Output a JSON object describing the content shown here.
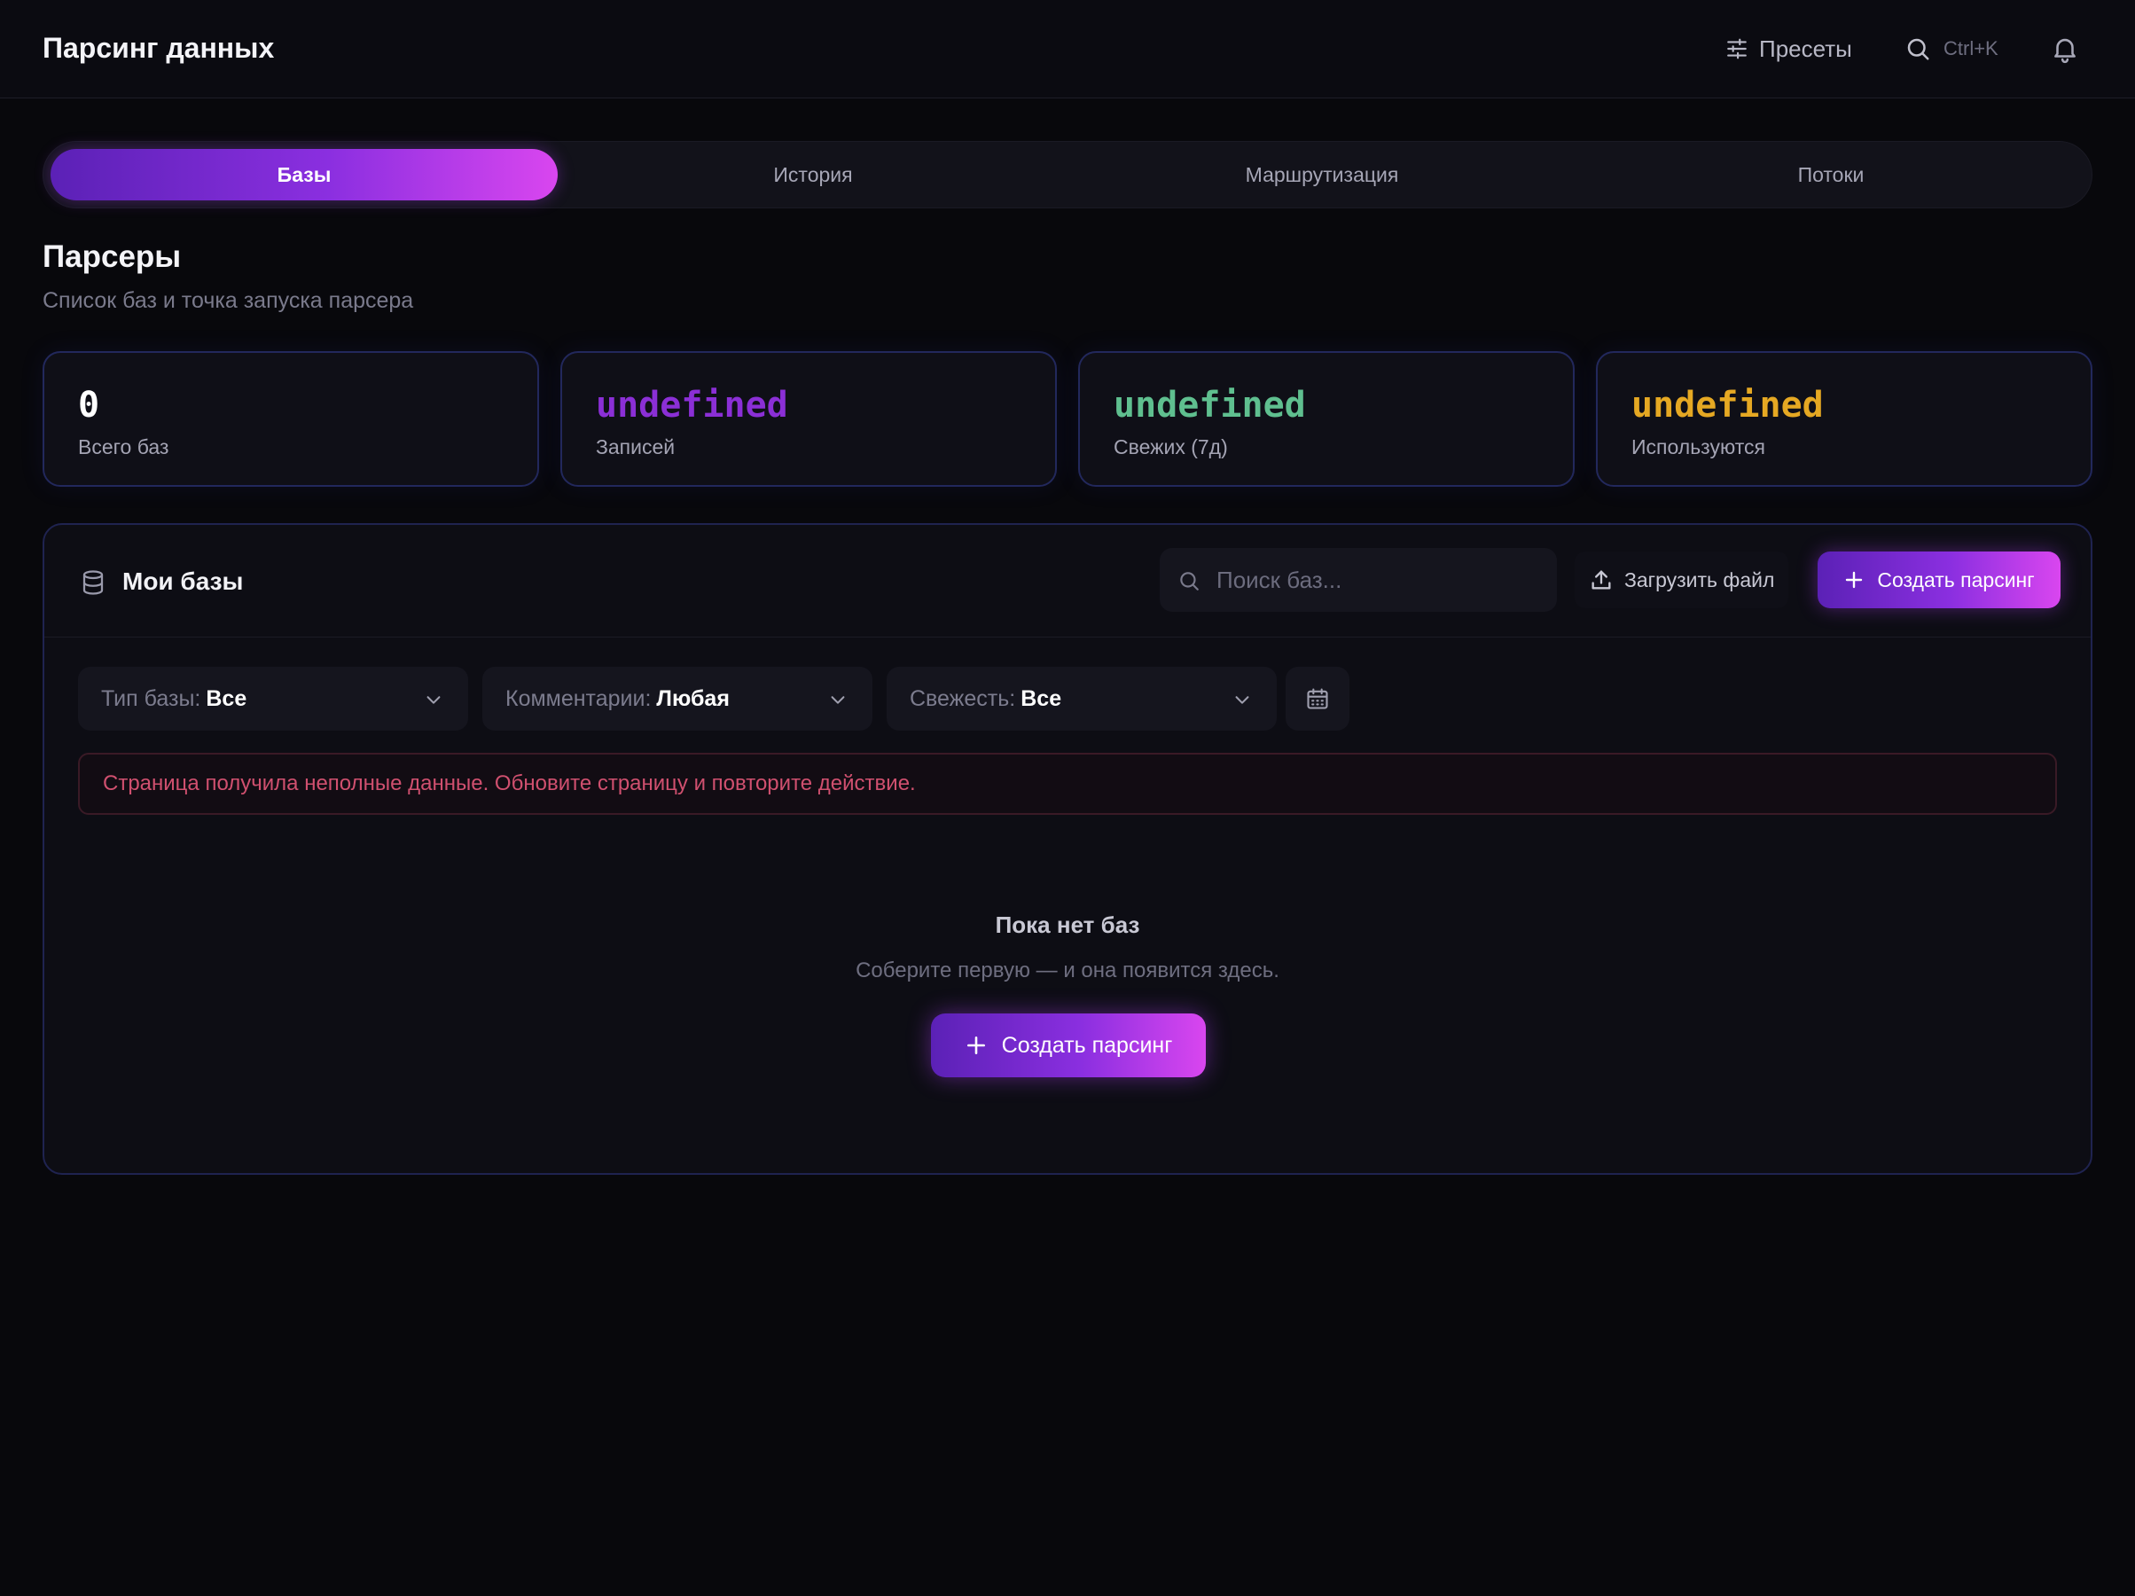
{
  "header": {
    "title": "Парсинг данных",
    "presets_label": "Пресеты",
    "search_shortcut": "Ctrl+K",
    "icons": [
      "sliders-icon",
      "search-icon",
      "bell-icon"
    ]
  },
  "tabs": [
    {
      "label": "Базы",
      "active": true
    },
    {
      "label": "История",
      "active": false
    },
    {
      "label": "Маршрутизация",
      "active": false
    },
    {
      "label": "Потоки",
      "active": false
    }
  ],
  "page": {
    "title": "Парсеры",
    "subtitle": "Список баз и точка запуска парсера"
  },
  "stats": [
    {
      "value": "0",
      "label": "Всего баз",
      "color": "#ffffff"
    },
    {
      "value": "undefined",
      "label": "Записей",
      "color": "#8b2fd6"
    },
    {
      "value": "undefined",
      "label": "Свежих (7д)",
      "color": "#5fbf8f"
    },
    {
      "value": "undefined",
      "label": "Используются",
      "color": "#e5a823"
    }
  ],
  "panel": {
    "title": "Мои базы",
    "search_placeholder": "Поиск баз...",
    "upload_label": "Загрузить файл",
    "create_label": "Создать парсинг"
  },
  "filters": [
    {
      "label": "Тип базы:",
      "value": "Все"
    },
    {
      "label": "Комментарии:",
      "value": "Любая"
    },
    {
      "label": "Свежесть:",
      "value": "Все"
    }
  ],
  "alert": {
    "text": "Страница получила неполные данные. Обновите страницу и повторите действие."
  },
  "empty": {
    "title": "Пока нет баз",
    "subtitle": "Соберите первую — и она появится здесь.",
    "button_label": "Создать парсинг"
  },
  "colors": {
    "accent_start": "#5b21b6",
    "accent_end": "#d946ef",
    "error": "#d0506f"
  }
}
